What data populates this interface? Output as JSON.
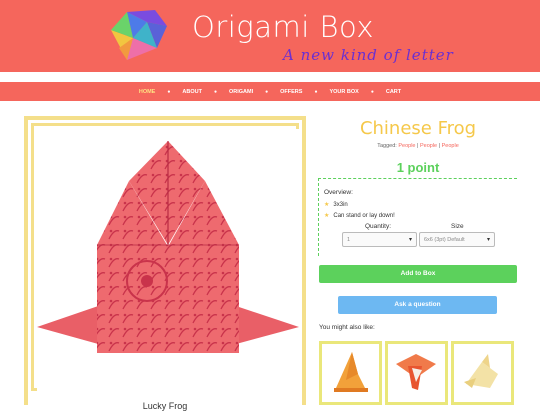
{
  "header": {
    "brand": "Origami Box",
    "tagline": "A new kind of letter",
    "logo_icon": "origami-box-logo-icon",
    "bg_color": "#f5665c"
  },
  "nav": {
    "items": [
      {
        "label": "HOME",
        "active": true
      },
      {
        "label": "ABOUT",
        "active": false
      },
      {
        "label": "ORIGAMI",
        "active": false
      },
      {
        "label": "OFFERS",
        "active": false
      },
      {
        "label": "YOUR BOX",
        "active": false
      },
      {
        "label": "CART",
        "active": false
      }
    ]
  },
  "product": {
    "title": "Chinese Frog",
    "tagged_label": "Tagged:",
    "tags": [
      "People",
      "People",
      "People"
    ],
    "points": "1 point",
    "image_caption": "Lucky Frog",
    "overview_label": "Overview:",
    "features": [
      "3x3in",
      "Can stand or lay down!"
    ],
    "quantity_label": "Quantity:",
    "quantity_value": "1",
    "size_label": "Size",
    "size_value": "6x6 (3pt) Default",
    "add_button": "Add to Box",
    "ask_button": "Ask a question",
    "also_like": "You might also like:"
  },
  "colors": {
    "accent_green": "#5cd15c",
    "accent_blue": "#6db8f2",
    "accent_yellow": "#f5c84a",
    "frame": "#f4df8a"
  }
}
